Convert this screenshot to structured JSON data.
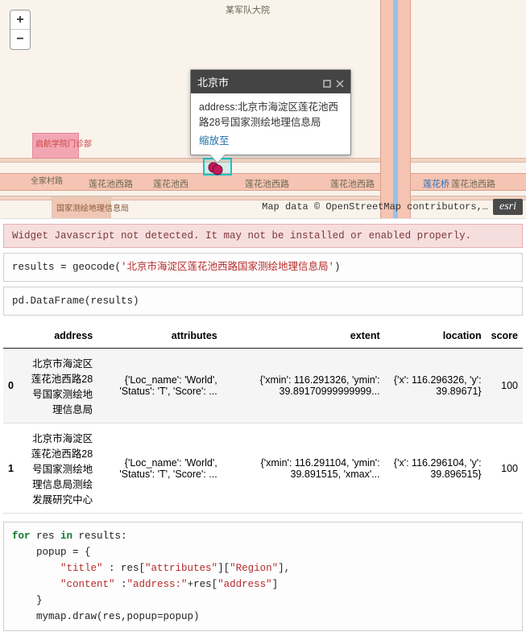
{
  "map": {
    "zoom_in": "+",
    "zoom_out": "−",
    "street_main": "莲花池西路",
    "street_alt1": "莲花池西",
    "street_alt2": "莲花桥",
    "poi1": "某军队大院",
    "poi2": "启航学院门诊部",
    "poi3": "国家测绘地理信息局",
    "poi4": "全家村路",
    "attribution": "Map data © OpenStreetMap contributors,…",
    "esri": "esri"
  },
  "popup": {
    "title": "北京市",
    "body_prefix": "address:",
    "body_text": "北京市海淀区莲花池西路28号国家测绘地理信息局",
    "link": "缩放至"
  },
  "warning": "Widget Javascript not detected.  It may not be installed or enabled properly.",
  "code1": {
    "plain": "results = geocode(",
    "str": "'北京市海淀区莲花池西路国家测绘地理信息局'",
    "plain2": ")"
  },
  "code2": "pd.DataFrame(results)",
  "table": {
    "headers": [
      "",
      "address",
      "attributes",
      "extent",
      "location",
      "score"
    ],
    "rows": [
      {
        "idx": "0",
        "address": "北京市海淀区莲花池西路28号国家测绘地理信息局",
        "attributes": "{'Loc_name': 'World', 'Status': 'T', 'Score': ...",
        "extent": "{'xmin': 116.291326, 'ymin': 39.89170999999999...",
        "location": "{'x': 116.296326, 'y': 39.89671}",
        "score": "100"
      },
      {
        "idx": "1",
        "address": "北京市海淀区莲花池西路28号国家测绘地理信息局测绘发展研究中心",
        "attributes": "{'Loc_name': 'World', 'Status': 'T', 'Score': ...",
        "extent": "{'xmin': 116.291104, 'ymin': 39.891515, 'xmax'...",
        "location": "{'x': 116.296104, 'y': 39.896515}",
        "score": "100"
      }
    ]
  },
  "code3": {
    "l1a": "for",
    "l1b": " res ",
    "l1c": "in",
    "l1d": " results:",
    "l2": "    popup = {",
    "l3a": "        ",
    "l3b": "\"title\"",
    "l3c": " : res[",
    "l3d": "\"attributes\"",
    "l3e": "][",
    "l3f": "\"Region\"",
    "l3g": "],",
    "l4a": "        ",
    "l4b": "\"content\"",
    "l4c": " :",
    "l4d": "\"address:\"",
    "l4e": "+res[",
    "l4f": "\"address\"",
    "l4g": "]",
    "l5": "    }",
    "l6": "    mymap.draw(res,popup=popup)"
  }
}
